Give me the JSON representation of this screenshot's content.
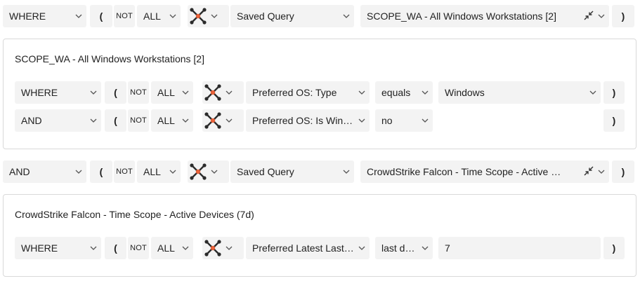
{
  "row1": {
    "operator": "WHERE",
    "paren_open": "(",
    "not": "NOT",
    "scope": "ALL",
    "field_icon": "crowdstrike-adapter-icon",
    "field": "Saved Query",
    "value": "SCOPE_WA - All Windows Workstations [2]",
    "paren_close": ")"
  },
  "panel1": {
    "title": "SCOPE_WA - All Windows Workstations [2]",
    "rows": [
      {
        "operator": "WHERE",
        "paren_open": "(",
        "not": "NOT",
        "scope": "ALL",
        "field": "Preferred OS: Type",
        "condition": "equals",
        "value": "Windows",
        "paren_close": ")"
      },
      {
        "operator": "AND",
        "paren_open": "(",
        "not": "NOT",
        "scope": "ALL",
        "field": "Preferred OS: Is Wind…",
        "condition": "no",
        "value": "",
        "paren_close": ")"
      }
    ]
  },
  "row2": {
    "operator": "AND",
    "paren_open": "(",
    "not": "NOT",
    "scope": "ALL",
    "field_icon": "crowdstrike-adapter-icon",
    "field": "Saved Query",
    "value": "CrowdStrike Falcon - Time Scope - Active …",
    "paren_close": ")"
  },
  "panel2": {
    "title": "CrowdStrike Falcon - Time Scope - Active Devices (7d)",
    "rows": [
      {
        "operator": "WHERE",
        "paren_open": "(",
        "not": "NOT",
        "scope": "ALL",
        "field": "Preferred Latest Last…",
        "condition": "last d…",
        "value": "7",
        "paren_close": ")"
      }
    ]
  },
  "colors": {
    "control_bg": "#f3f3f3",
    "panel_border": "#d9d9d9",
    "icon_dark": "#2b2b2b",
    "icon_accent": "#e8623a"
  }
}
